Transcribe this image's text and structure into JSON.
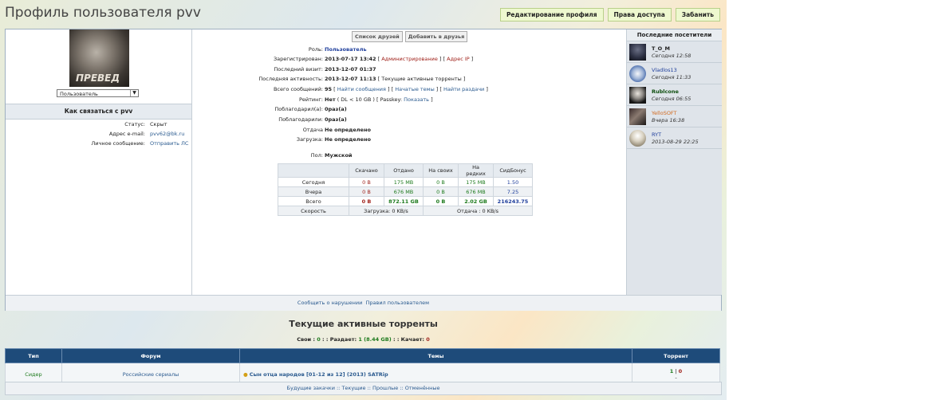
{
  "page": {
    "title": "Профиль пользователя pvv"
  },
  "top_buttons": [
    "Редактирование профиля",
    "Права доступа",
    "Забанить"
  ],
  "avatar": {
    "caption": "ПРЕВЕД"
  },
  "role_select": {
    "value": "Пользователь"
  },
  "contact": {
    "title": "Как связаться с pvv",
    "status_label": "Статус:",
    "status_value": "Скрыт",
    "email_label": "Адрес e-mail:",
    "email_value": "pvv62@bk.ru",
    "pm_label": "Личное сообщение:",
    "pm_value": "Отправить ЛС"
  },
  "friends": {
    "list": "Список друзей",
    "add": "Добавить в друзья"
  },
  "profile": {
    "role_label": "Роль:",
    "role_value": "Пользователь",
    "reg_label": "Зарегистрирован:",
    "reg_value": "2013-07-17 13:42",
    "reg_link1": "Администрирование",
    "reg_link2": "Адрес IP",
    "visit_label": "Последний визит:",
    "visit_value": "2013-12-07 01:37",
    "activity_label": "Последняя активность:",
    "activity_value": "2013-12-07 11:13",
    "activity_link": "Текущие активные торренты",
    "posts_label": "Всего сообщений:",
    "posts_value": "95",
    "posts_link1": "Найти сообщения",
    "posts_link2": "Начатые темы",
    "posts_link3": "Найти раздачи",
    "rating_label": "Рейтинг:",
    "rating_value": "Нет",
    "rating_note": "( DL < 10 GB )  [ Passkey:",
    "rating_link": "Показать",
    "thanked_label": "Поблагодарил(а):",
    "thanked_value": "0раз(а)",
    "thanked_by_label": "Поблагодарили:",
    "thanked_by_value": "0раз(а)",
    "upload_label": "Отдача",
    "upload_value": "Не определено",
    "download_label": "Загрузка:",
    "download_value": "Не определено",
    "gender_label": "Пол:",
    "gender_value": "Мужской"
  },
  "stats_table": {
    "headers": [
      "",
      "Скачано",
      "Отдано",
      "На своих",
      "На редких",
      "СидБонус"
    ],
    "rows": [
      [
        "Сегодня",
        "0 B",
        "175 MB",
        "0 B",
        "175 MB",
        "1.50"
      ],
      [
        "Вчера",
        "0 B",
        "676 MB",
        "0 B",
        "676 MB",
        "7.25"
      ],
      [
        "Всего",
        "0 B",
        "872.11 GB",
        "0 B",
        "2.02 GB",
        "216243.75"
      ]
    ],
    "speed_label": "Скорость",
    "speed_down": "Загрузка: 0 KB/s",
    "speed_up": "Отдача : 0 KB/s"
  },
  "visitors": {
    "title": "Последние посетители",
    "items": [
      {
        "name": "T_O_M",
        "time": "Сегодня 12:58"
      },
      {
        "name": "Vladlos13",
        "time": "Сегодня 11:33"
      },
      {
        "name": "Rublcone",
        "time": "Сегодня 06:55"
      },
      {
        "name": "YelloSOFT",
        "time": "Вчера 16:38"
      },
      {
        "name": "RYT",
        "time": "2013-08-29 22:25"
      }
    ]
  },
  "panel_footer": {
    "report": "Сообщить о нарушении",
    "rules": "Правил пользователем"
  },
  "active": {
    "title": "Текущие активные торренты",
    "own_label": "Свои :",
    "own_value": "0",
    "seed_label": ": : Раздает:",
    "seed_value": "1 (8.44 GB)",
    "leech_label": ": : Качает:",
    "leech_value": "0"
  },
  "torrent_table": {
    "headers": [
      "Тип",
      "Форум",
      "Темы",
      "Торрент"
    ],
    "row": {
      "type": "Сидер",
      "forum": "Российские сериалы",
      "topic": "Сын отца народов [01-12 из 12] (2013) SATRip",
      "seeds": "1",
      "leech": "0",
      "dash": "-"
    }
  },
  "bottom_links": {
    "text": "Будущие закачки :: Текущие :: Прошлые :: Отменённые"
  }
}
